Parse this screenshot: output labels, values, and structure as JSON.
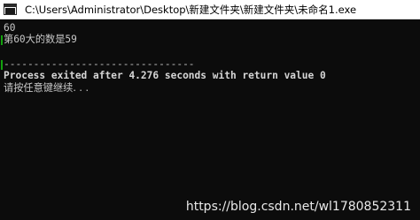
{
  "window": {
    "title": "C:\\Users\\Administrator\\Desktop\\新建文件夹\\新建文件夹\\未命名1.exe",
    "icon": "console-app-icon"
  },
  "console": {
    "lines": [
      "60",
      "第60大的数是59",
      "--------------------------------",
      "Process exited after 4.276 seconds with return value 0",
      "请按任意键继续. . ."
    ],
    "text_color": "#c8c8c8",
    "background_color": "#0c0c0c"
  },
  "watermark": "https://blog.csdn.net/wl1780852311"
}
